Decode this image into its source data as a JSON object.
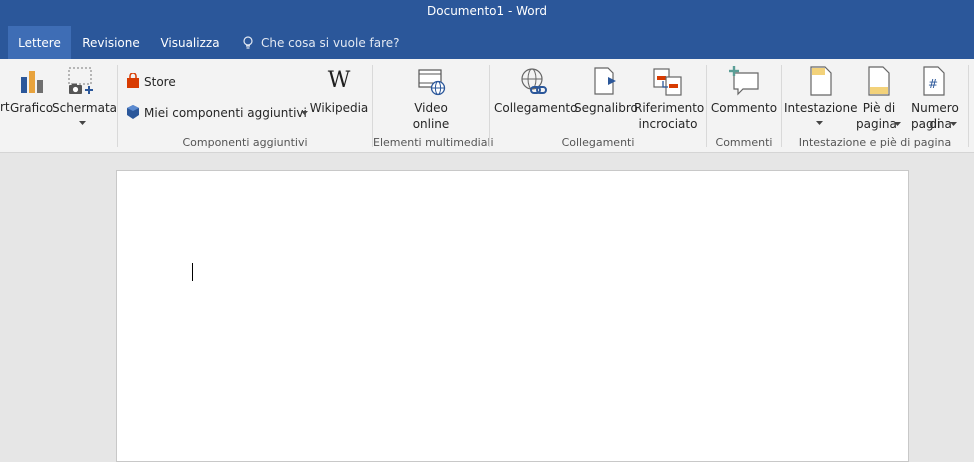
{
  "window": {
    "title": "Documento1  -  Word"
  },
  "tabs": [
    "Lettere",
    "Revisione",
    "Visualizza"
  ],
  "tell_me": {
    "placeholder": "Che cosa si vuole fare?"
  },
  "ribbon": {
    "partial_label": "rt",
    "illustrations": {
      "grafico": "Grafico",
      "schermata": "Schermata"
    },
    "addins": {
      "store": "Store",
      "my_addins": "Miei componenti aggiuntivi",
      "wikipedia": "Wikipedia",
      "group_label": "Componenti aggiuntivi"
    },
    "media": {
      "video_line1": "Video",
      "video_line2": "online",
      "group_label": "Elementi multimediali"
    },
    "links": {
      "collegamento": "Collegamento",
      "segnalibro": "Segnalibro",
      "riferimento_line1": "Riferimento",
      "riferimento_line2": "incrociato",
      "group_label": "Collegamenti"
    },
    "comments": {
      "commento": "Commento",
      "group_label": "Commenti"
    },
    "header_footer": {
      "intestazione": "Intestazione",
      "pie_line1": "Piè di",
      "pie_line2": "pagina",
      "numero_line1": "Numero di",
      "numero_line2": "pagina",
      "group_label": "Intestazione e piè di pagina"
    }
  },
  "colors": {
    "title_bar": "#2b579a",
    "active_tab": "#3e6db5",
    "ribbon": "#f3f3f3",
    "workspace": "#e6e6e6"
  }
}
